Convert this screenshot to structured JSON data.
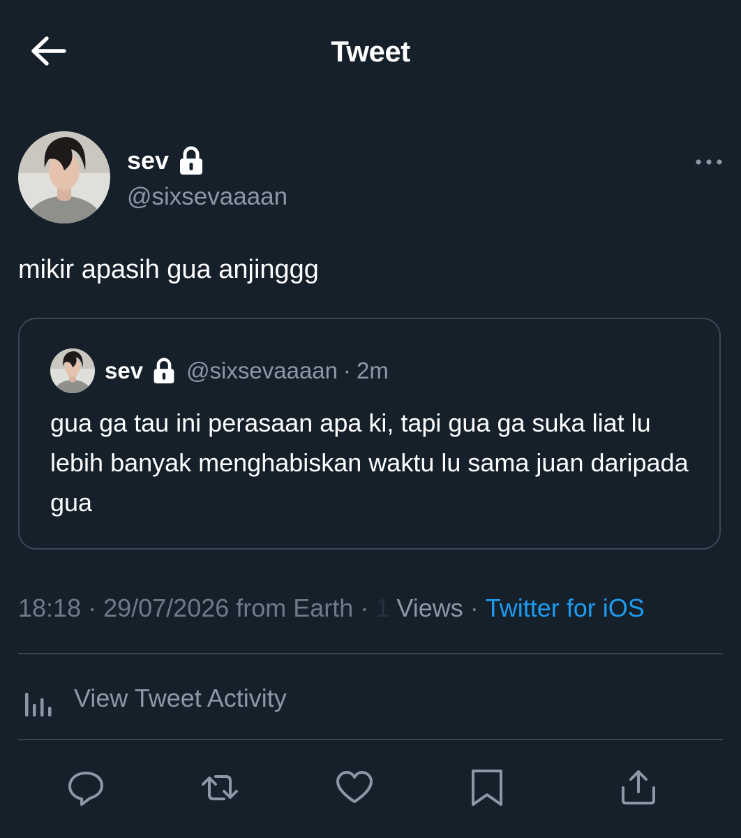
{
  "header": {
    "title": "Tweet",
    "back_icon": "arrow-left-icon"
  },
  "tweet": {
    "author": {
      "name": "sev",
      "handle": "@sixsevaaaan",
      "protected_icon": "lock-icon"
    },
    "more_icon": "more-horizontal-icon",
    "text": "mikir apasih gua anjinggg",
    "quoted": {
      "name": "sev",
      "handle": "@sixsevaaaan",
      "separator": "·",
      "time": "2m",
      "text": "gua ga tau ini perasaan apa ki, tapi gua ga suka liat lu lebih banyak menghabiskan waktu lu sama juan daripada gua"
    },
    "meta": {
      "time": "18:18",
      "date_location": "29/07/2026 from Earth",
      "separator": "·",
      "views_count": "1",
      "views_label": "Views",
      "source": "Twitter for iOS"
    },
    "activity_label": "View Tweet Activity"
  },
  "actions": [
    "reply-icon",
    "retweet-icon",
    "like-icon",
    "bookmark-icon",
    "share-icon"
  ],
  "colors": {
    "background": "#15202b",
    "text": "#ffffff",
    "secondary": "#8b98a5",
    "accent": "#1d9bf0",
    "border": "#38444d"
  }
}
